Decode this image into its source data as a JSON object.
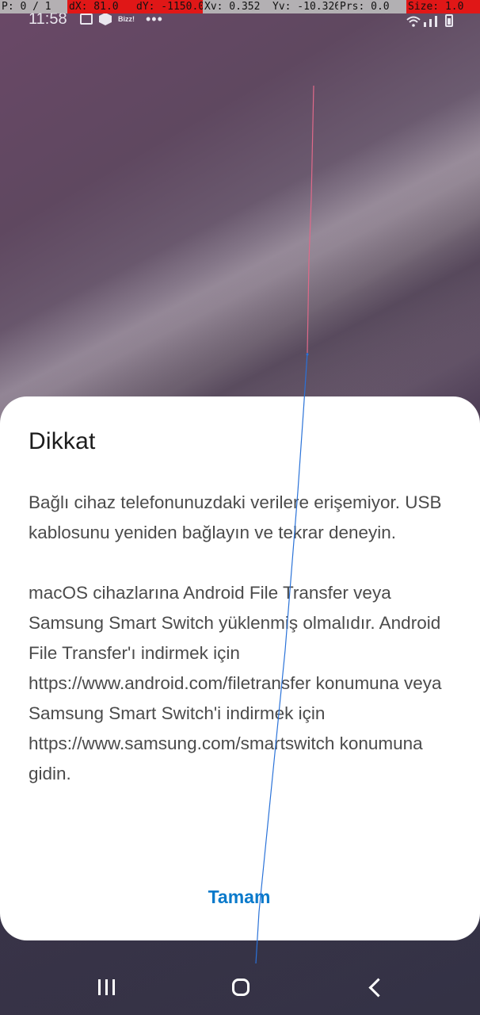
{
  "debug_overlay": {
    "pointer": "P: 0 / 1",
    "dx": "dX: 81.0",
    "dy": "dY: -1150.0",
    "xv": "Xv: 0.352",
    "yv": "Yv: -10.326",
    "prs": "Prs: 0.0",
    "size": "Size: 1.0"
  },
  "status_bar": {
    "time": "11:58",
    "notification_text": "Bizz!",
    "more_indicator": "•••",
    "icons": [
      "gallery-icon",
      "box-icon",
      "wifi-icon",
      "signal-icon",
      "battery-charging-icon"
    ]
  },
  "dialog": {
    "title": "Dikkat",
    "paragraph_1": "Bağlı cihaz telefonunuzdaki verilere erişemiyor. USB kablosunu yeniden bağlayın ve tekrar deneyin.",
    "paragraph_2": "macOS cihazlarına Android File Transfer veya Samsung Smart Switch yüklenmiş olmalıdır. Android File Transfer'ı indirmek için https://www.android.com/filetransfer konumuna veya Samsung Smart Switch'i indirmek için https://www.samsung.com/smartswitch konumuna gidin.",
    "button_label": "Tamam"
  },
  "navigation_bar": {
    "buttons": [
      "recents-icon",
      "home-icon",
      "back-icon"
    ]
  },
  "colors": {
    "accent": "#0a7acb",
    "dialog_background": "#ffffff",
    "debug_highlight": "#e01717"
  }
}
